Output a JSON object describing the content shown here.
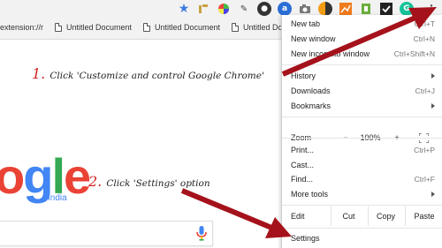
{
  "bookmarks": {
    "items": [
      {
        "label": "extension://r"
      },
      {
        "label": "Untitled Document"
      },
      {
        "label": "Untitled Document"
      },
      {
        "label": "Untitled Document"
      }
    ]
  },
  "google": {
    "letters": [
      "o",
      "g",
      "l",
      "e"
    ],
    "region": "India"
  },
  "annotations": {
    "step1_num": "1.",
    "step1_text": "Click 'Customize and control Google Chrome'",
    "step2_num": "2.",
    "step2_text": "Click 'Settings' option"
  },
  "menu": {
    "new_tab": "New tab",
    "new_tab_sc": "Ctrl+T",
    "new_window": "New window",
    "new_window_sc": "Ctrl+N",
    "new_incognito": "New incognito window",
    "new_incognito_sc": "Ctrl+Shift+N",
    "history": "History",
    "downloads": "Downloads",
    "downloads_sc": "Ctrl+J",
    "bookmarks": "Bookmarks",
    "zoom_label": "Zoom",
    "zoom_minus": "−",
    "zoom_value": "100%",
    "zoom_plus": "+",
    "print": "Print...",
    "print_sc": "Ctrl+P",
    "cast": "Cast...",
    "find": "Find...",
    "find_sc": "Ctrl+F",
    "more_tools": "More tools",
    "edit_label": "Edit",
    "cut": "Cut",
    "copy": "Copy",
    "paste": "Paste",
    "settings": "Settings"
  },
  "colors": {
    "arrow": "#a5121b",
    "annotation_number": "#d0211f",
    "google_blue": "#4285f4",
    "google_red": "#ea4335",
    "google_yellow": "#fbbc05",
    "google_green": "#34a853"
  },
  "icons": [
    "star-icon",
    "extension-icons",
    "chrome-menu-icon",
    "document-icon",
    "microphone-icon",
    "fullscreen-icon"
  ]
}
